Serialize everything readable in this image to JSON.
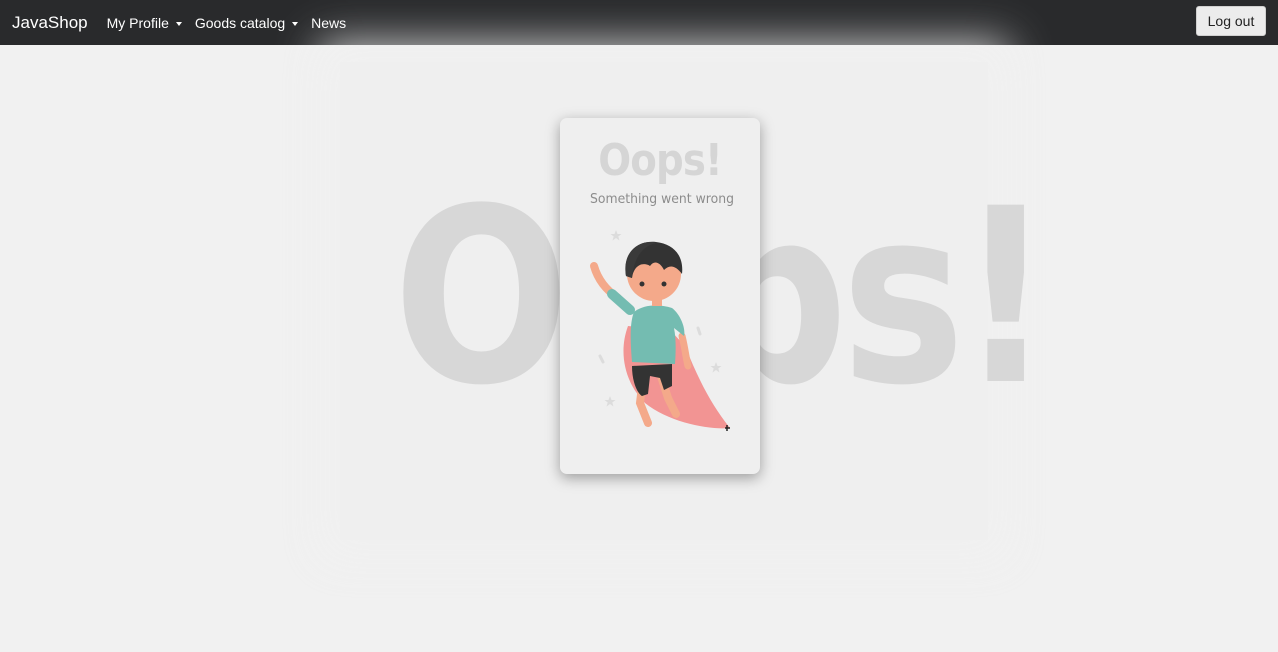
{
  "navbar": {
    "brand": "JavaShop",
    "items": [
      {
        "label": "My Profile",
        "dropdown": true
      },
      {
        "label": "Goods catalog",
        "dropdown": true
      },
      {
        "label": "News",
        "dropdown": false
      }
    ],
    "logout_label": "Log out"
  },
  "error": {
    "background_text": "Oops!",
    "title": "Oops!",
    "subtitle": "Something went wrong"
  },
  "colors": {
    "navbar_bg": "#292a2c",
    "page_bg": "#f1f1f1",
    "shirt": "#74bcb1",
    "cape": "#f29493",
    "skin": "#f4a98a",
    "hair": "#333333"
  }
}
